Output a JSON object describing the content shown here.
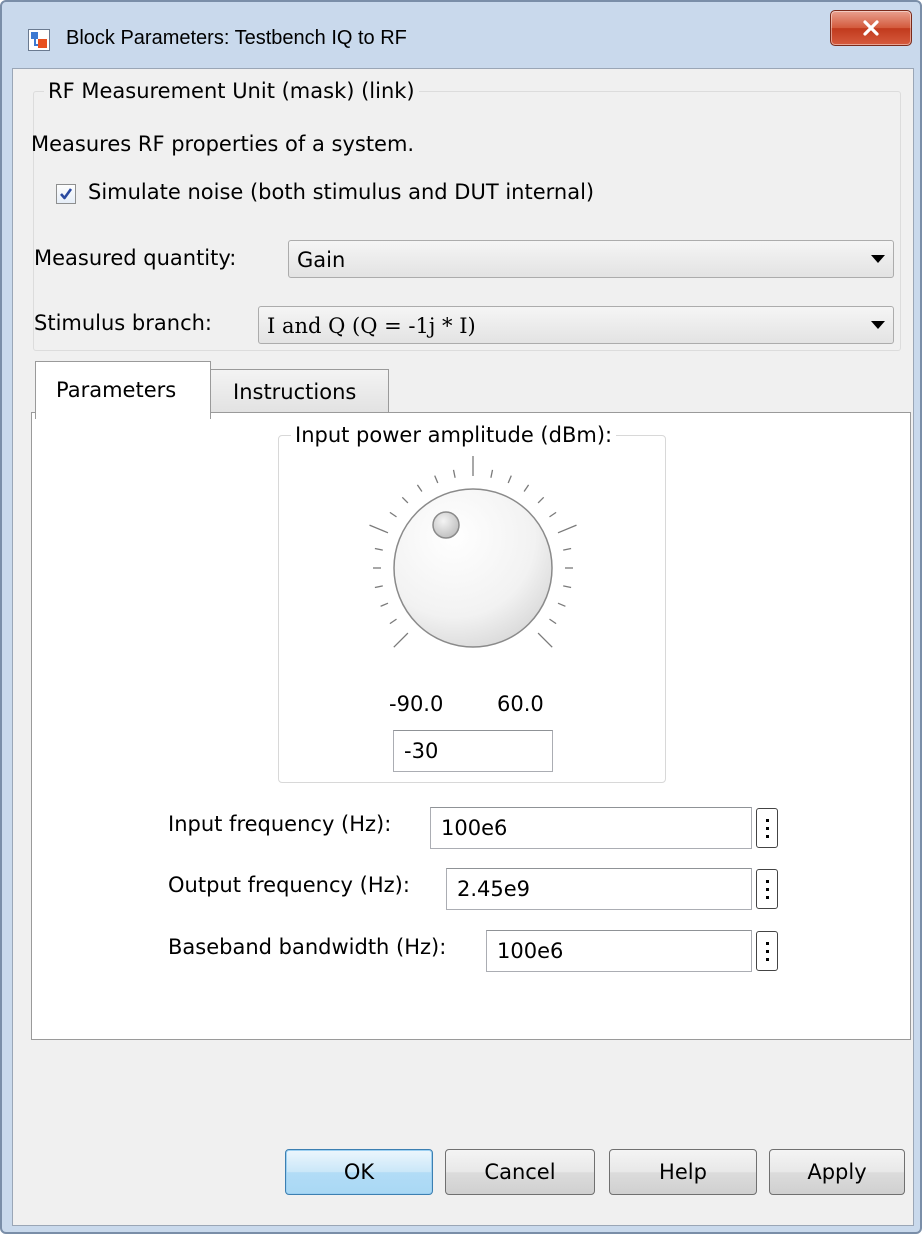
{
  "window": {
    "title": "Block Parameters: Testbench IQ to RF"
  },
  "mask": {
    "group_title": "RF Measurement Unit (mask) (link)",
    "description": "Measures RF properties of a system.",
    "simulate_noise": {
      "label": "Simulate noise (both stimulus and DUT internal)",
      "checked": true
    },
    "measured_quantity": {
      "label": "Measured quantity:",
      "value": "Gain"
    },
    "stimulus_branch": {
      "label": "Stimulus branch:",
      "value": "I and Q (Q = -1j * I)"
    }
  },
  "tabs": [
    {
      "label": "Parameters",
      "active": true
    },
    {
      "label": "Instructions",
      "active": false
    }
  ],
  "parameters": {
    "input_power": {
      "label": "Input power amplitude (dBm):",
      "min": "-90.0",
      "max": "60.0",
      "value": "-30"
    },
    "input_frequency": {
      "label": "Input frequency (Hz):",
      "value": "100e6"
    },
    "output_frequency": {
      "label": "Output frequency (Hz):",
      "value": "2.45e9"
    },
    "baseband_bandwidth": {
      "label": "Baseband bandwidth (Hz):",
      "value": "100e6"
    }
  },
  "buttons": {
    "ok": "OK",
    "cancel": "Cancel",
    "help": "Help",
    "apply": "Apply"
  },
  "icons": {
    "app": "simulink-block-icon",
    "close": "close-icon",
    "checkbox": "checkmark-icon",
    "dropdown": "dropdown-arrow-icon",
    "more": "more-options-icon"
  }
}
